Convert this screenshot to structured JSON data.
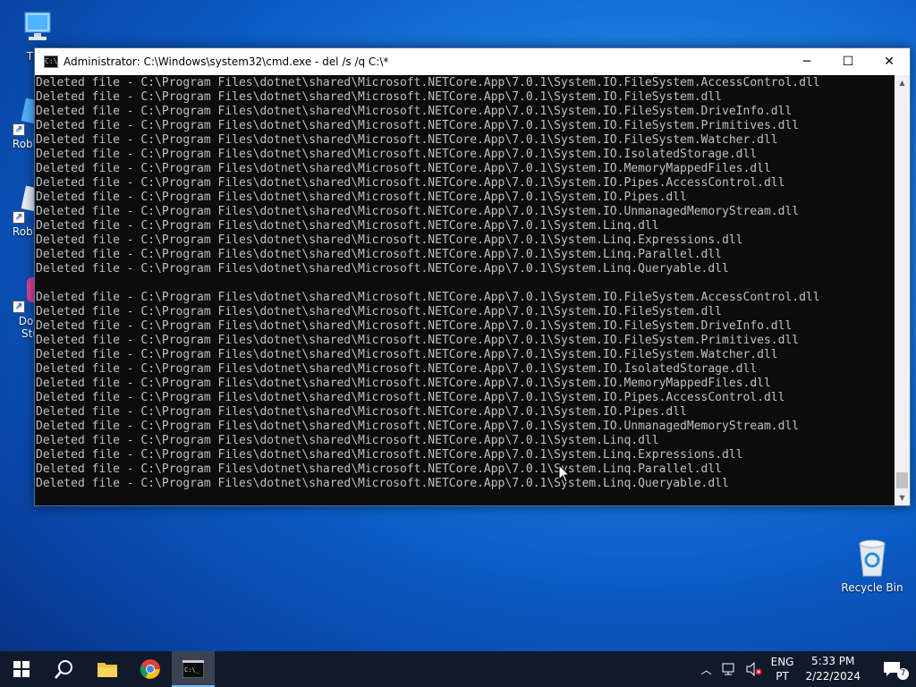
{
  "desktop": {
    "icons": [
      {
        "label": "This"
      },
      {
        "label": "Roblox"
      },
      {
        "label": "Roblox"
      },
      {
        "label": "Dow",
        "label2": "Stu"
      }
    ],
    "recycle_bin": {
      "label": "Recycle Bin"
    }
  },
  "cmd": {
    "title": "Administrator: C:\\Windows\\system32\\cmd.exe - del  /s /q C:\\*",
    "controls": {
      "minimize": "─",
      "maximize": "☐",
      "close": "✕"
    },
    "lines": [
      "Deleted file - C:\\Program Files\\dotnet\\shared\\Microsoft.NETCore.App\\7.0.1\\System.IO.FileSystem.AccessControl.dll",
      "Deleted file - C:\\Program Files\\dotnet\\shared\\Microsoft.NETCore.App\\7.0.1\\System.IO.FileSystem.dll",
      "Deleted file - C:\\Program Files\\dotnet\\shared\\Microsoft.NETCore.App\\7.0.1\\System.IO.FileSystem.DriveInfo.dll",
      "Deleted file - C:\\Program Files\\dotnet\\shared\\Microsoft.NETCore.App\\7.0.1\\System.IO.FileSystem.Primitives.dll",
      "Deleted file - C:\\Program Files\\dotnet\\shared\\Microsoft.NETCore.App\\7.0.1\\System.IO.FileSystem.Watcher.dll",
      "Deleted file - C:\\Program Files\\dotnet\\shared\\Microsoft.NETCore.App\\7.0.1\\System.IO.IsolatedStorage.dll",
      "Deleted file - C:\\Program Files\\dotnet\\shared\\Microsoft.NETCore.App\\7.0.1\\System.IO.MemoryMappedFiles.dll",
      "Deleted file - C:\\Program Files\\dotnet\\shared\\Microsoft.NETCore.App\\7.0.1\\System.IO.Pipes.AccessControl.dll",
      "Deleted file - C:\\Program Files\\dotnet\\shared\\Microsoft.NETCore.App\\7.0.1\\System.IO.Pipes.dll",
      "Deleted file - C:\\Program Files\\dotnet\\shared\\Microsoft.NETCore.App\\7.0.1\\System.IO.UnmanagedMemoryStream.dll",
      "Deleted file - C:\\Program Files\\dotnet\\shared\\Microsoft.NETCore.App\\7.0.1\\System.Linq.dll",
      "Deleted file - C:\\Program Files\\dotnet\\shared\\Microsoft.NETCore.App\\7.0.1\\System.Linq.Expressions.dll",
      "Deleted file - C:\\Program Files\\dotnet\\shared\\Microsoft.NETCore.App\\7.0.1\\System.Linq.Parallel.dll",
      "Deleted file - C:\\Program Files\\dotnet\\shared\\Microsoft.NETCore.App\\7.0.1\\System.Linq.Queryable.dll",
      "",
      "Deleted file - C:\\Program Files\\dotnet\\shared\\Microsoft.NETCore.App\\7.0.1\\System.IO.FileSystem.AccessControl.dll",
      "Deleted file - C:\\Program Files\\dotnet\\shared\\Microsoft.NETCore.App\\7.0.1\\System.IO.FileSystem.dll",
      "Deleted file - C:\\Program Files\\dotnet\\shared\\Microsoft.NETCore.App\\7.0.1\\System.IO.FileSystem.DriveInfo.dll",
      "Deleted file - C:\\Program Files\\dotnet\\shared\\Microsoft.NETCore.App\\7.0.1\\System.IO.FileSystem.Primitives.dll",
      "Deleted file - C:\\Program Files\\dotnet\\shared\\Microsoft.NETCore.App\\7.0.1\\System.IO.FileSystem.Watcher.dll",
      "Deleted file - C:\\Program Files\\dotnet\\shared\\Microsoft.NETCore.App\\7.0.1\\System.IO.IsolatedStorage.dll",
      "Deleted file - C:\\Program Files\\dotnet\\shared\\Microsoft.NETCore.App\\7.0.1\\System.IO.MemoryMappedFiles.dll",
      "Deleted file - C:\\Program Files\\dotnet\\shared\\Microsoft.NETCore.App\\7.0.1\\System.IO.Pipes.AccessControl.dll",
      "Deleted file - C:\\Program Files\\dotnet\\shared\\Microsoft.NETCore.App\\7.0.1\\System.IO.Pipes.dll",
      "Deleted file - C:\\Program Files\\dotnet\\shared\\Microsoft.NETCore.App\\7.0.1\\System.IO.UnmanagedMemoryStream.dll",
      "Deleted file - C:\\Program Files\\dotnet\\shared\\Microsoft.NETCore.App\\7.0.1\\System.Linq.dll",
      "Deleted file - C:\\Program Files\\dotnet\\shared\\Microsoft.NETCore.App\\7.0.1\\System.Linq.Expressions.dll",
      "Deleted file - C:\\Program Files\\dotnet\\shared\\Microsoft.NETCore.App\\7.0.1\\System.Linq.Parallel.dll",
      "Deleted file - C:\\Program Files\\dotnet\\shared\\Microsoft.NETCore.App\\7.0.1\\System.Linq.Queryable.dll"
    ]
  },
  "taskbar": {
    "pinned": [
      "start-icon",
      "search-icon",
      "file-explorer-icon",
      "chrome-icon",
      "command-prompt-icon"
    ],
    "tray": {
      "lang_top": "ENG",
      "lang_bottom": "PT",
      "time": "5:33 PM",
      "date": "2/22/2024",
      "notification_count": "7"
    }
  },
  "colors": {
    "console_bg": "#0c0c0c",
    "console_text": "#c0c0c0",
    "taskbar": "#101a2a",
    "accent": "#76b9ed"
  }
}
